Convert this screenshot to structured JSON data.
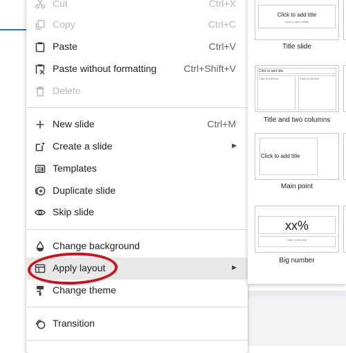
{
  "menu": {
    "items": [
      {
        "label": "Cut",
        "shortcut": "Ctrl+X",
        "icon": "scissors-icon"
      },
      {
        "label": "Copy",
        "shortcut": "Ctrl+C",
        "icon": "copy-icon"
      },
      {
        "label": "Paste",
        "shortcut": "Ctrl+V",
        "icon": "clipboard-icon"
      },
      {
        "label": "Paste without formatting",
        "shortcut": "Ctrl+Shift+V",
        "icon": "paste-plain-icon"
      },
      {
        "label": "Delete",
        "shortcut": "",
        "icon": "trash-icon"
      },
      {
        "label": "New slide",
        "shortcut": "Ctrl+M",
        "icon": "plus-icon"
      },
      {
        "label": "Create a slide",
        "shortcut": "",
        "icon": "sparkle-slide-icon"
      },
      {
        "label": "Templates",
        "shortcut": "",
        "icon": "template-icon"
      },
      {
        "label": "Duplicate slide",
        "shortcut": "",
        "icon": "duplicate-icon"
      },
      {
        "label": "Skip slide",
        "shortcut": "",
        "icon": "eye-icon"
      },
      {
        "label": "Change background",
        "shortcut": "",
        "icon": "paint-drop-icon"
      },
      {
        "label": "Apply layout",
        "shortcut": "",
        "icon": "layout-icon"
      },
      {
        "label": "Change theme",
        "shortcut": "",
        "icon": "paint-roller-icon"
      },
      {
        "label": "Transition",
        "shortcut": "",
        "icon": "transition-icon"
      }
    ]
  },
  "layouts": {
    "title_slide": {
      "label": "Title slide",
      "title_text": "Click to add title",
      "subtitle_text": "Click to add subtitle"
    },
    "title_two_columns": {
      "label": "Title and two columns",
      "title_text": "Click to add title",
      "col_text": "Click to add text"
    },
    "main_point": {
      "label": "Main point",
      "title_text": "Click to add title"
    },
    "big_number": {
      "label": "Big number",
      "number_text": "xx%",
      "sub_text": "Click to add text"
    }
  },
  "colors": {
    "highlight": "#e8e8e8",
    "annotation": "#d0101a",
    "accent": "#1a73e8"
  }
}
